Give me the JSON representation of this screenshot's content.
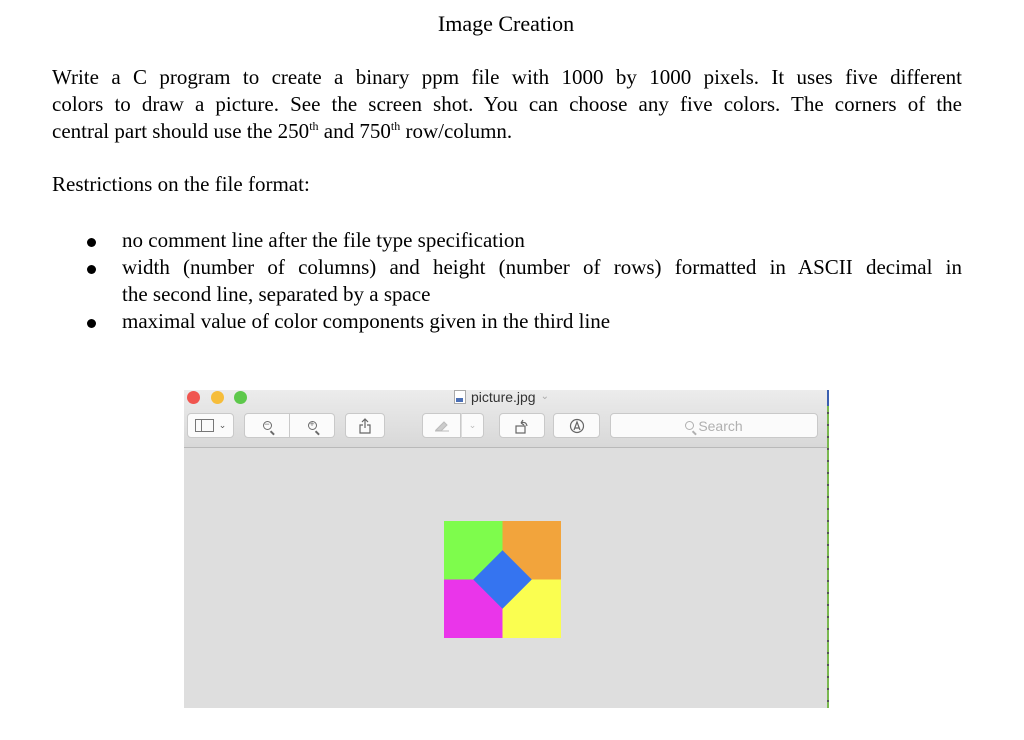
{
  "document": {
    "title": "Image Creation",
    "intro": {
      "line1": "Write a C program to create a binary ppm file with 1000 by 1000 pixels. It uses five different",
      "line2": "colors to draw a picture. See the screen shot. You can choose any five colors. The corners of the",
      "line3_pre": "central part should use the 250",
      "sup1": "th",
      "line3_mid": " and 750",
      "sup2": "th",
      "line3_post": " row/column."
    },
    "restrictions_heading": "Restrictions on the file format:",
    "restrictions": [
      {
        "text": "no comment line after the file type specification"
      },
      {
        "line1": "width (number of columns) and height (number of rows) formatted in ASCII decimal in",
        "line2": "the second line, separated by a space"
      },
      {
        "text": "maximal value of color components given in the third line"
      }
    ]
  },
  "preview_window": {
    "file_name": "picture.jpg",
    "search_placeholder": "Search",
    "toolbar": {
      "sidebar_button": "sidebar-toggle",
      "zoom_out": "−",
      "zoom_in": "+",
      "share": "share",
      "markup": "markup",
      "rotate": "rotate",
      "annotate": "annotate"
    },
    "picture": {
      "colors": {
        "top_left": "#7efc4c",
        "top_right": "#f2a43c",
        "bottom_left": "#ea35ea",
        "bottom_right": "#fafe50",
        "center": "#3574f0"
      },
      "corner_row_col": [
        250,
        750
      ],
      "size": [
        1000,
        1000
      ]
    }
  }
}
